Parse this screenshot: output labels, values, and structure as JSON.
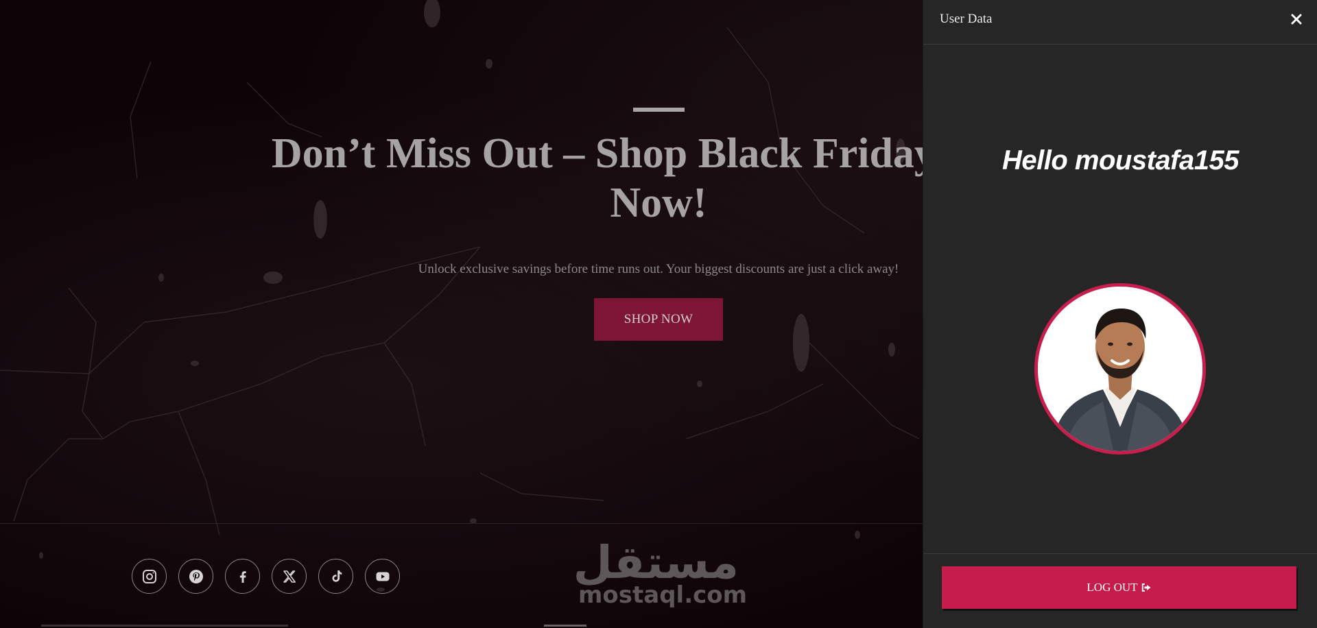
{
  "hero": {
    "title": "Don’t Miss Out – Shop Black Friday Deals Now!",
    "subtitle": "Unlock exclusive savings before time runs out. Your biggest discounts are just a click away!",
    "cta_label": "SHOP NOW"
  },
  "socials": [
    {
      "icon": "instagram-icon"
    },
    {
      "icon": "pinterest-icon"
    },
    {
      "icon": "facebook-icon"
    },
    {
      "icon": "x-twitter-icon"
    },
    {
      "icon": "tiktok-icon"
    },
    {
      "icon": "youtube-icon"
    }
  ],
  "watermark": {
    "arabic": "مستقل",
    "latin": "mostaql.com"
  },
  "panel": {
    "title": "User Data",
    "greeting": "Hello moustafa155",
    "logout_label": "LOG OUT",
    "logout_icon": "sign-out-icon",
    "close_icon": "close-icon"
  },
  "colors": {
    "accent": "#c51c4c",
    "cta_dim": "#7d1535",
    "panel_bg": "#262626",
    "hero_bg": "#0e0408"
  }
}
